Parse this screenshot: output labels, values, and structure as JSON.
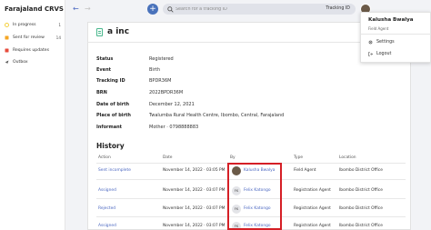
{
  "app": {
    "brand": "Farajaland CRVS"
  },
  "sidebar": {
    "items": [
      {
        "label": "In progress",
        "count": "1",
        "color": "#f4d03f"
      },
      {
        "label": "Sent for review",
        "count": "14",
        "color": "#f5a623"
      },
      {
        "label": "Requires updates",
        "count": "",
        "color": "#e74c3c"
      },
      {
        "label": "Outbox",
        "count": "",
        "color": "#555555"
      }
    ]
  },
  "topbar": {
    "search_placeholder": "Search for a tracking ID",
    "search_type": "Tracking ID"
  },
  "record": {
    "title": "a inc",
    "fields": [
      {
        "label": "Status",
        "value": "Registered"
      },
      {
        "label": "Event",
        "value": "Birth"
      },
      {
        "label": "Tracking ID",
        "value": "BPDR36M"
      },
      {
        "label": "BRN",
        "value": "2022BPDR36M"
      },
      {
        "label": "Date of birth",
        "value": "December 12, 2021"
      },
      {
        "label": "Place of birth",
        "value": "Twalumba Rural Health Centre, Ibombo, Central, Farajaland"
      },
      {
        "label": "Informant",
        "value": "Mother · 0798888883"
      }
    ]
  },
  "history": {
    "title": "History",
    "headers": [
      "Action",
      "Date",
      "By",
      "Type",
      "Location"
    ],
    "rows": [
      {
        "action": "Sent incomplete",
        "date": "November 14, 2022 · 03:05 PM",
        "by_initials": "",
        "by": "Kalusha Bwalya",
        "type": "Field Agent",
        "location": "Ibombo District Office"
      },
      {
        "action": "Assigned",
        "date": "November 14, 2022 · 03:07 PM",
        "by_initials": "FK",
        "by": "Felix Katongo",
        "type": "Registration Agent",
        "location": "Ibombo District Office"
      },
      {
        "action": "Rejected",
        "date": "November 14, 2022 · 03:07 PM",
        "by_initials": "FK",
        "by": "Felix Katongo",
        "type": "Registration Agent",
        "location": "Ibombo District Office"
      },
      {
        "action": "Assigned",
        "date": "November 14, 2022 · 03:07 PM",
        "by_initials": "FK",
        "by": "Felix Katongo",
        "type": "Registration Agent",
        "location": "Ibombo District Office"
      }
    ]
  },
  "user_menu": {
    "name": "Kalusha Bwalya",
    "role": "Field Agent",
    "items": [
      "Settings",
      "Logout"
    ]
  },
  "colors": {
    "accent": "#4972bb",
    "link": "#4c68c1",
    "highlight": "#d51f26"
  }
}
